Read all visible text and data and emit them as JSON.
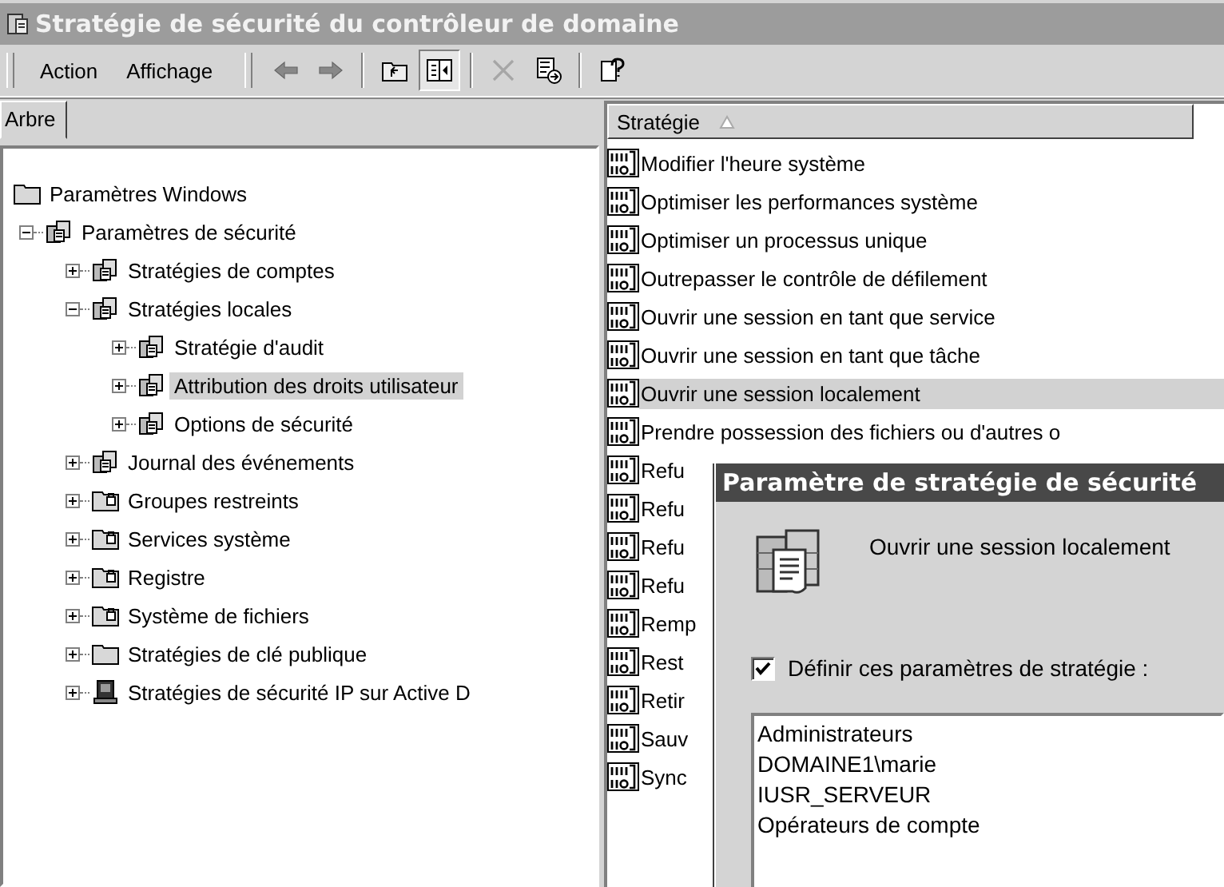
{
  "window": {
    "title": "Stratégie de sécurité du contrôleur de domaine"
  },
  "menu": [
    {
      "label": "Action"
    },
    {
      "label": "Affichage"
    }
  ],
  "toolbar": [
    {
      "kind": "back",
      "disabled": false
    },
    {
      "kind": "forward",
      "disabled": false
    },
    {
      "kind": "sep"
    },
    {
      "kind": "up",
      "disabled": false
    },
    {
      "kind": "tree",
      "pressed": true
    },
    {
      "kind": "sep"
    },
    {
      "kind": "delete",
      "disabled": true
    },
    {
      "kind": "export",
      "disabled": false
    },
    {
      "kind": "sep"
    },
    {
      "kind": "help",
      "disabled": false
    }
  ],
  "tree_tab": {
    "label": "Arbre"
  },
  "tree": [
    {
      "label": "Paramètres Windows",
      "kind": "folder",
      "selected": false,
      "children": [
        {
          "label": "Paramètres de sécurité",
          "kind": "policy",
          "expanded": true,
          "selected": false,
          "children": [
            {
              "label": "Stratégies de comptes",
              "kind": "policy",
              "expanded": false,
              "selected": false
            },
            {
              "label": "Stratégies locales",
              "kind": "policy",
              "expanded": true,
              "selected": false,
              "children": [
                {
                  "label": "Stratégie d'audit",
                  "kind": "policy",
                  "expanded": false,
                  "selected": false
                },
                {
                  "label": "Attribution des droits utilisateur",
                  "kind": "policy",
                  "expanded": false,
                  "selected": true
                },
                {
                  "label": "Options de sécurité",
                  "kind": "policy",
                  "expanded": false,
                  "selected": false
                }
              ]
            },
            {
              "label": "Journal des événements",
              "kind": "policy",
              "expanded": false,
              "selected": false
            },
            {
              "label": "Groupes restreints",
              "kind": "lockfolder",
              "expanded": false,
              "selected": false
            },
            {
              "label": "Services système",
              "kind": "lockfolder",
              "expanded": false,
              "selected": false
            },
            {
              "label": "Registre",
              "kind": "lockfolder",
              "expanded": false,
              "selected": false
            },
            {
              "label": "Système de fichiers",
              "kind": "lockfolder",
              "expanded": false,
              "selected": false
            },
            {
              "label": "Stratégies de clé publique",
              "kind": "folder",
              "expanded": false,
              "selected": false
            },
            {
              "label": "Stratégies de sécurité IP sur Active D",
              "kind": "computer",
              "expanded": false,
              "selected": false
            }
          ]
        }
      ]
    }
  ],
  "list": {
    "column": "Stratégie",
    "rows": [
      {
        "label": "Modifier l'heure système",
        "selected": false
      },
      {
        "label": "Optimiser les performances système",
        "selected": false
      },
      {
        "label": "Optimiser un processus unique",
        "selected": false
      },
      {
        "label": "Outrepasser le contrôle de défilement",
        "selected": false
      },
      {
        "label": "Ouvrir une session en tant que service",
        "selected": false
      },
      {
        "label": "Ouvrir une session en tant que tâche",
        "selected": false
      },
      {
        "label": "Ouvrir une session localement",
        "selected": true
      },
      {
        "label": "Prendre possession des fichiers ou d'autres o",
        "selected": false
      },
      {
        "label": "Refu",
        "selected": false
      },
      {
        "label": "Refu",
        "selected": false
      },
      {
        "label": "Refu",
        "selected": false
      },
      {
        "label": "Refu",
        "selected": false
      },
      {
        "label": "Remp",
        "selected": false
      },
      {
        "label": "Rest",
        "selected": false
      },
      {
        "label": "Retir",
        "selected": false
      },
      {
        "label": "Sauv",
        "selected": false
      },
      {
        "label": "Sync",
        "selected": false
      }
    ]
  },
  "dialog": {
    "title": "Paramètre de stratégie de sécurité",
    "policy": "Ouvrir une session localement",
    "define": {
      "label": "Définir ces paramètres de stratégie :",
      "checked": true
    },
    "accounts": [
      "Administrateurs",
      "DOMAINE1\\marie",
      "IUSR_SERVEUR",
      "Opérateurs de compte"
    ]
  }
}
